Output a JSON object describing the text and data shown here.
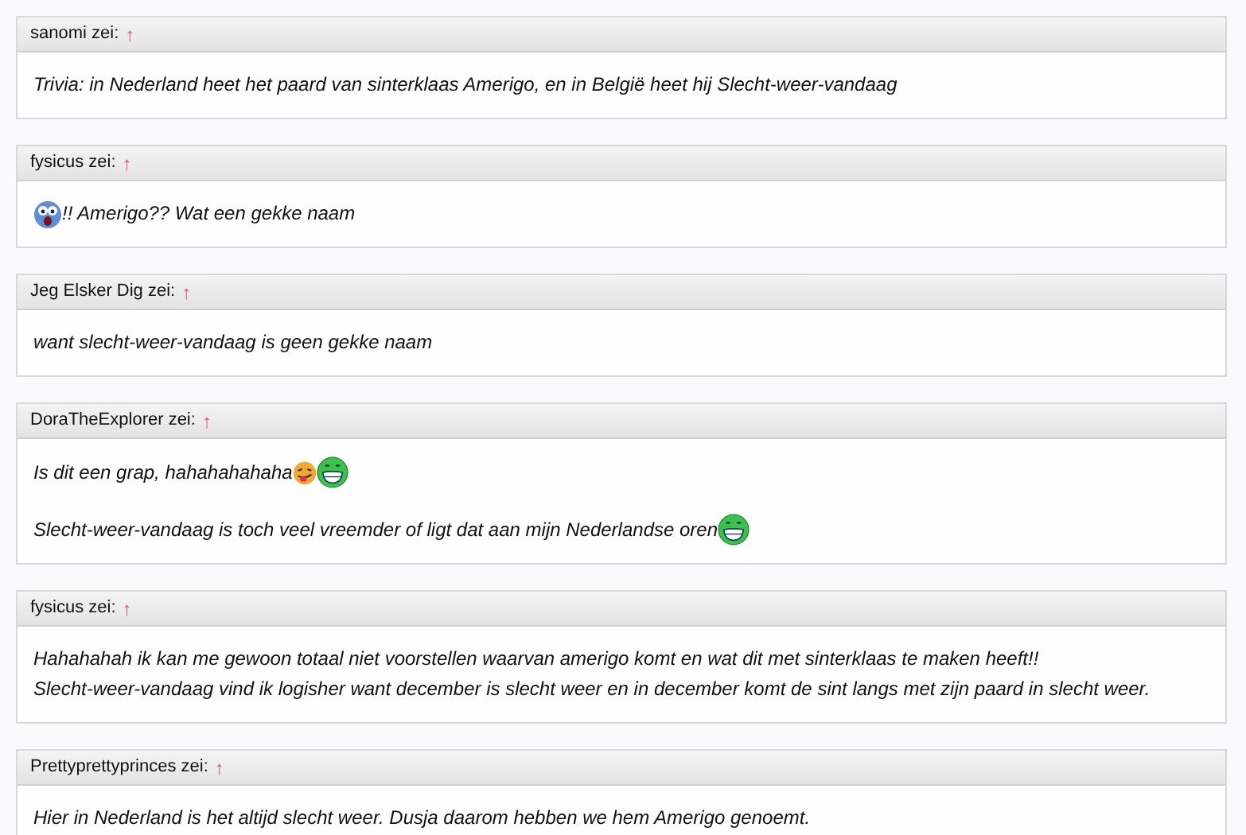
{
  "posts": [
    {
      "author": "sanomi zei:",
      "arrow": "↑",
      "paragraphs": [
        [
          [
            {
              "kind": "text",
              "text": "Trivia: in Nederland heet het paard van sinterklaas Amerigo, en in België heet hij Slecht-weer-vandaag"
            }
          ]
        ]
      ]
    },
    {
      "author": "fysicus zei:",
      "arrow": "↑",
      "paragraphs": [
        [
          [
            {
              "kind": "shocked"
            },
            {
              "kind": "text",
              "text": "!! Amerigo?? Wat een gekke naam"
            }
          ]
        ]
      ]
    },
    {
      "author": "Jeg Elsker Dig zei:",
      "arrow": "↑",
      "paragraphs": [
        [
          [
            {
              "kind": "text",
              "text": "want slecht-weer-vandaag is geen gekke naam"
            }
          ]
        ]
      ]
    },
    {
      "author": "DoraTheExplorer zei:",
      "arrow": "↑",
      "paragraphs": [
        [
          [
            {
              "kind": "text",
              "text": "Is dit een grap, hahahahahaha"
            },
            {
              "kind": "tongue"
            },
            {
              "kind": "grin"
            }
          ]
        ],
        [
          [
            {
              "kind": "text",
              "text": "Slecht-weer-vandaag is toch veel vreemder of ligt dat aan mijn Nederlandse oren"
            },
            {
              "kind": "grin"
            }
          ]
        ]
      ]
    },
    {
      "author": "fysicus zei:",
      "arrow": "↑",
      "paragraphs": [
        [
          [
            {
              "kind": "text",
              "text": "Hahahahah ik kan me gewoon totaal niet voorstellen waarvan amerigo komt en wat dit met sinterklaas te maken heeft!!"
            }
          ],
          [
            {
              "kind": "text",
              "text": "Slecht-weer-vandaag vind ik logisher want december is slecht weer en in december komt de sint langs met zijn paard in slecht weer."
            }
          ]
        ]
      ]
    },
    {
      "author": "Prettyprettyprinces zei:",
      "arrow": "↑",
      "paragraphs": [
        [
          [
            {
              "kind": "text",
              "text": "Hier in Nederland is het altijd slecht weer. Dusja daarom hebben we hem Amerigo genoemt."
            }
          ]
        ]
      ]
    }
  ]
}
